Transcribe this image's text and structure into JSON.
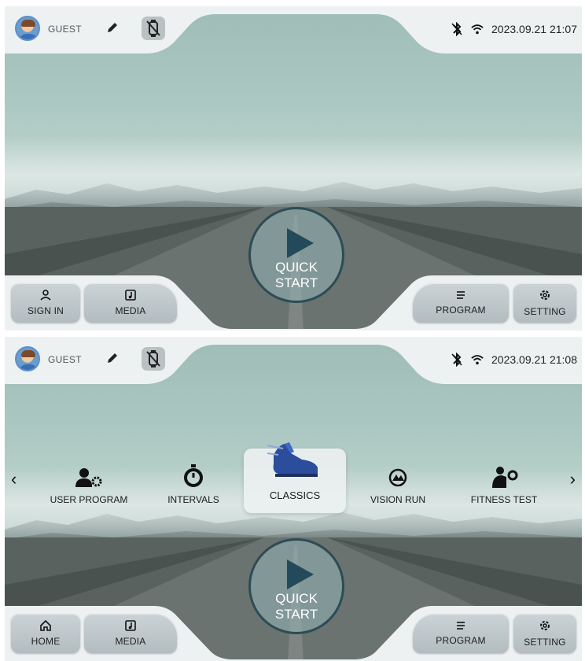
{
  "screens": [
    {
      "user": {
        "name": "GUEST"
      },
      "status": {
        "datetime": "2023.09.21 21:07"
      },
      "quick_start": {
        "line1": "QUICK",
        "line2": "START"
      },
      "nav": {
        "left1": "SIGN IN",
        "left2": "MEDIA",
        "right1": "PROGRAM",
        "right2": "SETTING"
      }
    },
    {
      "user": {
        "name": "GUEST"
      },
      "status": {
        "datetime": "2023.09.21 21:08"
      },
      "quick_start": {
        "line1": "QUICK",
        "line2": "START"
      },
      "programs": [
        {
          "label": "USER PROGRAM",
          "icon": "user-gear-icon"
        },
        {
          "label": "INTERVALS",
          "icon": "stopwatch-icon"
        },
        {
          "label": "CLASSICS",
          "icon": "running-shoe-icon",
          "selected": true
        },
        {
          "label": "VISION RUN",
          "icon": "vision-run-icon"
        },
        {
          "label": "FITNESS TEST",
          "icon": "fitness-test-icon"
        }
      ],
      "nav": {
        "left1": "HOME",
        "left2": "MEDIA",
        "right1": "PROGRAM",
        "right2": "SETTING"
      }
    }
  ],
  "icons": {
    "arrow_left": "‹",
    "arrow_right": "›"
  },
  "colors": {
    "accent": "#234a5a",
    "button": "#bfc7cb",
    "bar": "#eef1f2"
  }
}
